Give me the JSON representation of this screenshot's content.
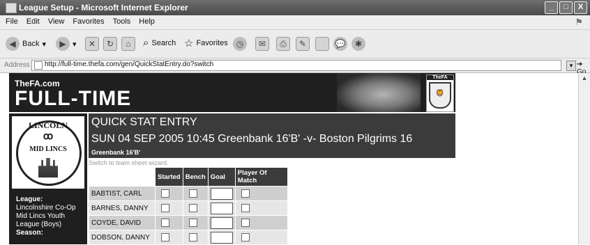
{
  "window": {
    "title": "League Setup - Microsoft Internet Explorer",
    "controls": [
      "_",
      "□",
      "X"
    ]
  },
  "menu": [
    "File",
    "Edit",
    "View",
    "Favorites",
    "Tools",
    "Help"
  ],
  "toolbar": {
    "back": "Back",
    "search": "Search",
    "favorites": "Favorites"
  },
  "address": {
    "label": "Address",
    "url": "http://full-time.thefa.com/gen/QuickStatEntry.do?switch",
    "go": "Go"
  },
  "banner": {
    "brand_small": "TheFA.com",
    "brand_big": "FULL-TIME",
    "crest_label": "TheFA"
  },
  "logo": {
    "top_text": "LINCOLN",
    "middle_text": "MID LINCS"
  },
  "sidebar": {
    "league_heading": "League:",
    "league_lines": [
      "Lincolnshire Co-Op",
      "Mid Lincs Youth",
      "League (Boys)"
    ],
    "season_heading": "Season:"
  },
  "header": {
    "title": "QUICK STAT ENTRY",
    "match": "SUN 04 SEP 2005 10:45 Greenbank 16'B' -v- Boston Pilgrims 16",
    "team": "Greenbank 16'B'"
  },
  "switch_link": "Switch to team sheet wizard.",
  "table": {
    "columns": [
      "",
      "Started",
      "Bench",
      "Goal",
      "Player Of Match"
    ],
    "players": [
      "BABTIST, CARL",
      "BARNES, DANNY",
      "COYDE, DAVID",
      "DOBSON, DANNY"
    ]
  }
}
